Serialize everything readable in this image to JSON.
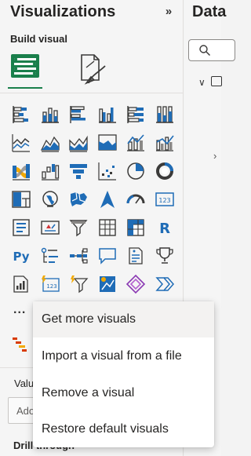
{
  "visualizations_pane": {
    "title": "Visualizations",
    "collapse_icon": "double-chevron-right-icon",
    "collapse_glyph": "»",
    "build_label": "Build visual",
    "modes": [
      {
        "name": "build-visual-mode",
        "icon": "build-visual-icon",
        "selected": true
      },
      {
        "name": "format-visual-mode",
        "icon": "format-visual-icon",
        "selected": false
      }
    ],
    "more_label": "...",
    "values_label": "Valu",
    "add_field_text": "Ado",
    "drill_label": "Drill through"
  },
  "data_pane": {
    "title": "Data",
    "search_icon": "search-icon",
    "tree_chevron": "∨",
    "tree_chevron_collapsed": "›"
  },
  "visual_icons": [
    [
      "stacked-bar-chart-icon",
      "stacked-column-chart-icon",
      "clustered-bar-chart-icon",
      "clustered-column-chart-icon",
      "100-stacked-bar-chart-icon",
      "100-stacked-column-chart-icon"
    ],
    [
      "line-chart-icon",
      "area-chart-icon",
      "stacked-area-chart-icon",
      "100-stacked-area-chart-icon",
      "line-and-stacked-column-chart-icon",
      "line-and-clustered-column-chart-icon"
    ],
    [
      "ribbon-chart-icon",
      "waterfall-chart-icon",
      "funnel-chart-icon",
      "scatter-chart-icon",
      "pie-chart-icon",
      "donut-chart-icon"
    ],
    [
      "treemap-icon",
      "map-icon",
      "filled-map-icon",
      "azure-map-icon",
      "gauge-icon",
      "card-icon"
    ],
    [
      "multi-row-card-icon",
      "kpi-icon",
      "slicer-icon",
      "table-icon",
      "matrix-icon",
      "r-script-visual-icon"
    ],
    [
      "python-visual-icon",
      "key-influencers-icon",
      "decomposition-tree-icon",
      "qa-icon",
      "smart-narrative-icon",
      "metrics-icon"
    ],
    [
      "paginated-report-icon",
      "new-card-icon",
      "new-slicer-icon",
      "azure-map-visual-icon",
      "power-apps-icon",
      "power-automate-icon"
    ]
  ],
  "context_menu": {
    "items": [
      {
        "label": "Get more visuals",
        "hover": true
      },
      {
        "label": "Import a visual from a file",
        "hover": false
      },
      {
        "label": "Remove a visual",
        "hover": false
      },
      {
        "label": "Restore default visuals",
        "hover": false
      }
    ]
  },
  "colors": {
    "accent_green": "#1a7f4b",
    "icon_blue": "#1f6cb6",
    "icon_dark": "#3b3a39",
    "icon_gray": "#8a8886"
  }
}
